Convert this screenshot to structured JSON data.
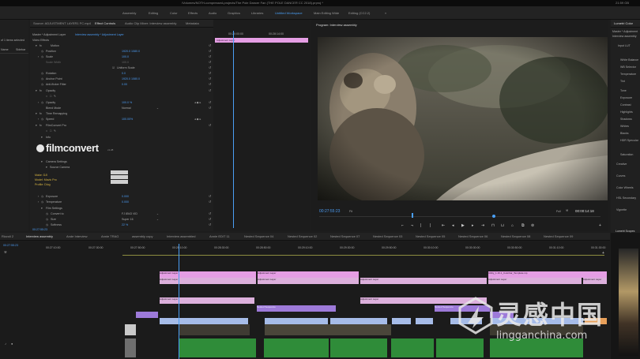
{
  "title_bar": {
    "path": "/Volumes/NOTH-compressed-projects/The Pole Dancer Fan (THE POLE DANCER CC 2018).prproj *",
    "clock": "21:59 GB"
  },
  "workspaces": [
    "Assembly",
    "Editing",
    "Color",
    "Effects",
    "Audio",
    "Graphics",
    "Libraries",
    "Untitled Workspace",
    "Main Editing Wide",
    "Editing (CC2.2)"
  ],
  "active_workspace": "Untitled Workspace",
  "more_label": "»",
  "project_panel": {
    "lines": [
      "of 1 items selected",
      "Name",
      "Sidebar"
    ]
  },
  "effect_controls": {
    "tabs": [
      "Source: ADJUSTMENT LAYER1 FC.mp4",
      "Effect Controls",
      "Audio Clip Mixer: Interview assembly",
      "Metadata"
    ],
    "active_tab": "Effect Controls",
    "master_label": "Master * Adjustment Layer",
    "sequence_label": "Interview assembly * Adjustment Layer",
    "section": "Video Effects",
    "rows": [
      {
        "name": "Motion",
        "value": ""
      },
      {
        "name": "Position",
        "value": "1920.0   1080.0"
      },
      {
        "name": "Scale",
        "value": "100.0"
      },
      {
        "name": "Scale Width",
        "value": "100.0"
      },
      {
        "name": "Uniform Scale",
        "value": ""
      },
      {
        "name": "Rotation",
        "value": "0.0"
      },
      {
        "name": "Anchor Point",
        "value": "1920.0   1080.0"
      },
      {
        "name": "Anti-flicker Filter",
        "value": "0.00"
      },
      {
        "name": "Opacity",
        "value": ""
      },
      {
        "name": "Opacity",
        "value": "100.0 %"
      },
      {
        "name": "Blend Mode",
        "value": "Normal"
      },
      {
        "name": "Time Remapping",
        "value": ""
      },
      {
        "name": "Speed",
        "value": "100.00%"
      },
      {
        "name": "FilmConvert Pro",
        "value": ""
      },
      {
        "name": "Info",
        "value": ""
      }
    ],
    "filmconvert_logo": "filmconvert",
    "filmconvert_version": "v1.28",
    "camera_rows": [
      "Camera Settings",
      "Source Camera"
    ],
    "camera_info": {
      "make": "Make: DJI",
      "model": "Model: Mavic Pro",
      "profile": "Profile: Dlog"
    },
    "lower_rows": [
      {
        "name": "Exposure",
        "value": "0.000"
      },
      {
        "name": "Temperature",
        "value": "0.000"
      },
      {
        "name": "Film Settings",
        "value": ""
      },
      {
        "name": "Convert to",
        "value": "FJ 8543 VID"
      },
      {
        "name": "Size",
        "value": "Super 16"
      },
      {
        "name": "Softness",
        "value": "22 %"
      }
    ],
    "timecode": "00:27:55:23"
  },
  "ec_timeline": {
    "start": "00:20:00:00",
    "end": "00:28:14:00",
    "clip_label": "Adjustment Layer"
  },
  "program": {
    "title": "Program: Interview assembly",
    "timecode": "00:27:55:23",
    "fit": "Fit",
    "quality": "Full",
    "duration": "00:00:14:18"
  },
  "lumetri": {
    "tab": "Lumetri Color",
    "lines": [
      "Master * Adjustment",
      "Interview assembly",
      "Input LUT",
      "White Balance",
      "WB Selector",
      "Temperature",
      "Tint",
      "Tone",
      "Exposure",
      "Contrast",
      "Highlights",
      "Shadows",
      "Whites",
      "Blacks",
      "HDR Specular",
      "Saturation",
      "Creative",
      "Curves",
      "Color Wheels",
      "HSL Secondary",
      "Vignette"
    ]
  },
  "timeline": {
    "tabs": [
      "Rizzoli 2",
      "Interview assembly",
      "Ande Interview",
      "Annie TRAG",
      "assembly copy",
      "Interview assembled",
      "Annie EDIT 11",
      "Nested Sequence 04",
      "Nested Sequence 02",
      "Nested Sequence 07",
      "Nested Sequence 03",
      "Nested Sequence 05",
      "Nested Sequence 06",
      "Nested Sequence 08",
      "Nested Sequence 09"
    ],
    "active_tab": "Interview assembly",
    "timecode": "00:27:55:23",
    "ruler": [
      "00:27:10:00",
      "00:27:30:00",
      "00:27:50:00",
      "00:28:10:00",
      "00:28:30:00",
      "00:28:50:00",
      "00:29:10:00",
      "00:29:30:00",
      "00:29:50:00",
      "00:30:10:00",
      "00:30:30:00",
      "00:30:50:00",
      "00:31:10:00",
      "00:31:30:00"
    ],
    "adjustment_label": "Adjustment Layer",
    "nested_label": "Nested Sequence",
    "utility_label": "Utility_1.16.1_Colorbar_Template.mp"
  },
  "scopes": {
    "tab": "Lumetri Scopes"
  },
  "watermark": {
    "cn": "灵感中国",
    "url": "lingganchina.com"
  },
  "colors": {
    "accent": "#4a9ff5",
    "adjustment": "#e59ee4",
    "nested": "#9d7ad9",
    "audio": "#2f8c39"
  }
}
